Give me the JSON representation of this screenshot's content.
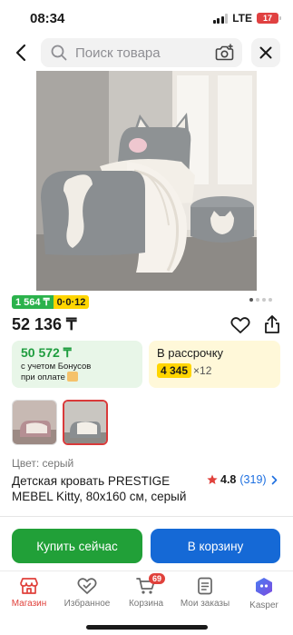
{
  "status_bar": {
    "time": "08:34",
    "network": "LTE",
    "battery": "17"
  },
  "search": {
    "placeholder": "Поиск товара"
  },
  "gallery": {
    "dots_count": 4,
    "active_dot": 0
  },
  "credit_badges": {
    "green": "1 564 ₸",
    "yellow": "0·0·12"
  },
  "price": "52 136 ₸",
  "bonus": {
    "amount": "50 572 ₸",
    "caption_line1": "с учетом Бонусов",
    "caption_line2": "при оплате"
  },
  "installment": {
    "title": "В рассрочку",
    "amount": "4 345",
    "term": "×12"
  },
  "color": "Цвет: серый",
  "product": {
    "title": "Детская кровать PRESTIGE MEBEL Kitty, 80x160 см, серый"
  },
  "rating": {
    "value": "4.8",
    "count": "(319)"
  },
  "actions": {
    "buy_now": "Купить сейчас",
    "add_to_cart": "В корзину"
  },
  "tabbar": {
    "items": [
      {
        "label": "Магазин",
        "icon": "shop-icon",
        "active": true
      },
      {
        "label": "Избранное",
        "icon": "heart-icon",
        "active": false
      },
      {
        "label": "Корзина",
        "icon": "cart-icon",
        "active": false,
        "badge": "69"
      },
      {
        "label": "Мои заказы",
        "icon": "orders-icon",
        "active": false
      },
      {
        "label": "Kasper",
        "icon": "kasper-icon",
        "active": false
      }
    ]
  },
  "colors": {
    "accent_red": "#e0413b",
    "buy_green": "#21a038",
    "cart_blue": "#1569d6",
    "bonus_green": "#1f9d3f",
    "installment_yellow": "#ffd500"
  }
}
